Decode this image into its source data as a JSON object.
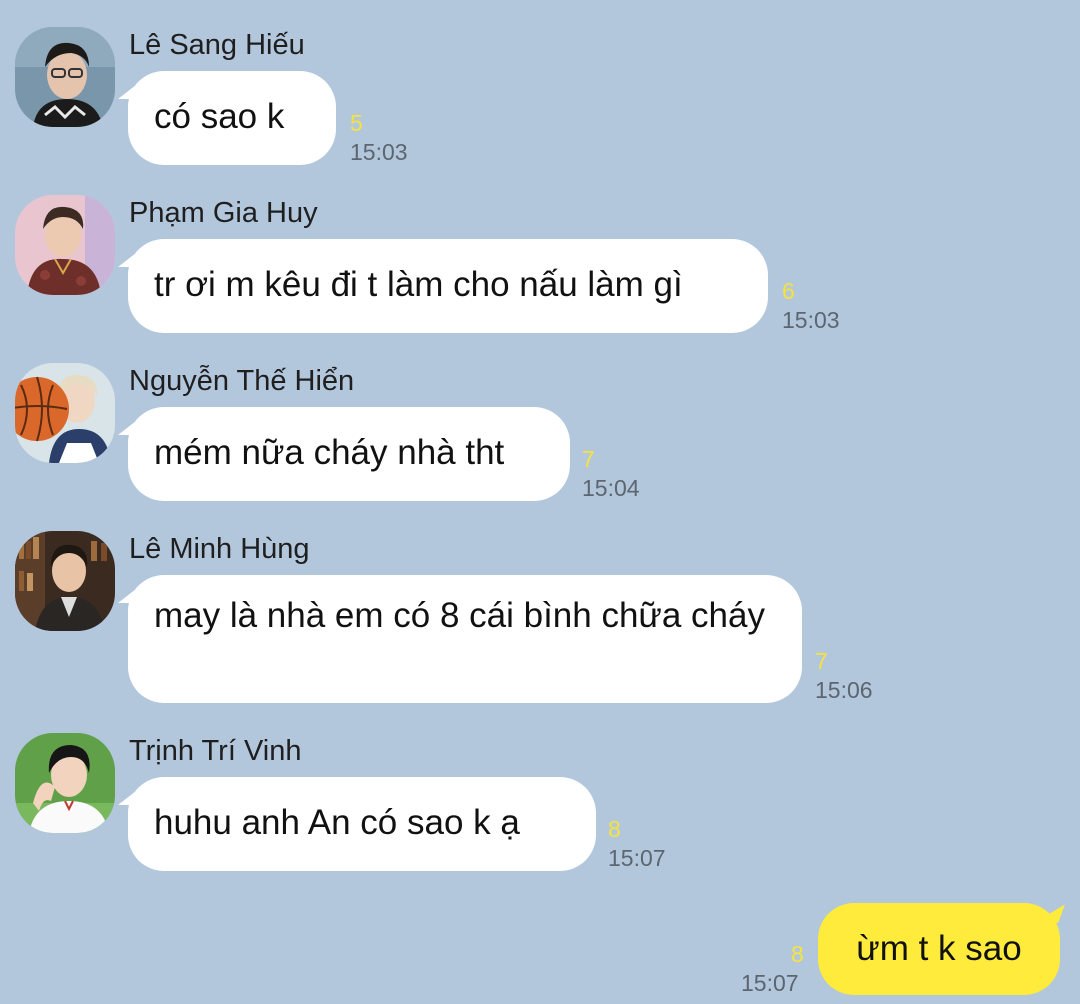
{
  "conversation": {
    "messages": [
      {
        "sender": "Lê Sang Hiếu",
        "text": "có sao k",
        "unread": "5",
        "time": "15:03"
      },
      {
        "sender": "Phạm Gia Huy",
        "text": "tr ơi m kêu đi t làm cho nấu làm gì",
        "unread": "6",
        "time": "15:03"
      },
      {
        "sender": "Nguyễn Thế Hiển",
        "text": "mém nữa cháy nhà tht",
        "unread": "7",
        "time": "15:04"
      },
      {
        "sender": "Lê Minh Hùng",
        "text": "may là nhà em có 8 cái bình chữa cháy",
        "unread": "7",
        "time": "15:06"
      },
      {
        "sender": "Trịnh Trí Vinh",
        "text": "huhu anh An có sao k ạ",
        "unread": "8",
        "time": "15:07"
      }
    ],
    "my_message": {
      "text": "ừm t k sao",
      "unread": "8",
      "time": "15:07"
    }
  },
  "colors": {
    "background": "#b2c6dc",
    "incoming_bubble": "#ffffff",
    "outgoing_bubble": "#ffeb3b",
    "unread_count": "#f6e33d"
  }
}
